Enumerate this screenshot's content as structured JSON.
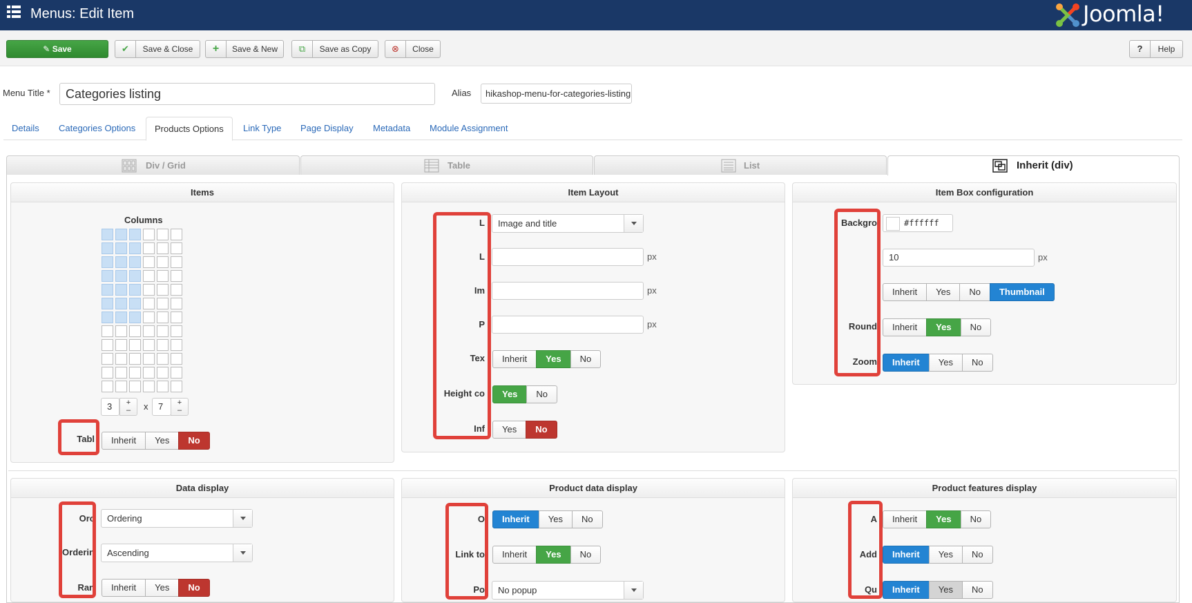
{
  "header": {
    "title": "Menus: Edit Item",
    "brand": "Joomla!",
    "bar_color": "#1a3867"
  },
  "toolbar": {
    "save": "Save",
    "save_close": "Save & Close",
    "save_new": "Save & New",
    "save_copy": "Save as Copy",
    "close": "Close",
    "help": "Help"
  },
  "form": {
    "menu_title_label": "Menu Title *",
    "menu_title_value": "Categories listing",
    "alias_label": "Alias",
    "alias_value": "hikashop-menu-for-categories-listing"
  },
  "tabs": [
    "Details",
    "Categories Options",
    "Products Options",
    "Link Type",
    "Page Display",
    "Metadata",
    "Module Assignment"
  ],
  "active_tab": "Products Options",
  "layout_tabs": [
    "Div / Grid",
    "Table",
    "List",
    "Inherit (div)"
  ],
  "active_layout_tab": "Inherit (div)",
  "items_panel": {
    "title": "Items",
    "columns_label": "Columns",
    "grid": {
      "cols": 6,
      "rows": 12,
      "selected_cols": 3,
      "selected_rows": 7
    },
    "cols_value": "3",
    "rows_value": "7",
    "times": "x",
    "plus": "+",
    "minus": "–",
    "table_label": "Tabl",
    "table_options": [
      "Inherit",
      "Yes",
      "No"
    ]
  },
  "item_layout_panel": {
    "title": "Item Layout",
    "labels": [
      "L",
      "L",
      "Im",
      "P",
      "Tex",
      "Height co",
      "Inf"
    ],
    "layout_select": "Image and title",
    "px": "px",
    "text_options": [
      "Inherit",
      "Yes",
      "No"
    ],
    "height_options": [
      "Yes",
      "No"
    ],
    "info_options": [
      "Yes",
      "No"
    ]
  },
  "item_box_panel": {
    "title": "Item Box configuration",
    "labels": [
      "Backgro",
      "Round",
      "Zoom"
    ],
    "color_value": "#ffffff",
    "padding_value": "10",
    "px": "px",
    "border_options": [
      "Inherit",
      "Yes",
      "No",
      "Thumbnail"
    ],
    "round_options": [
      "Inherit",
      "Yes",
      "No"
    ],
    "zoom_options": [
      "Inherit",
      "Yes",
      "No"
    ]
  },
  "data_display_panel": {
    "title": "Data display",
    "labels": [
      "Orc",
      "Orderin",
      "Ran"
    ],
    "order_select": "Ordering",
    "direction_select": "Ascending",
    "random_options": [
      "Inherit",
      "Yes",
      "No"
    ]
  },
  "product_data_panel": {
    "title": "Product data display",
    "labels": [
      "O",
      "Link to",
      "Po"
    ],
    "o_options": [
      "Inherit",
      "Yes",
      "No"
    ],
    "link_options": [
      "Inherit",
      "Yes",
      "No"
    ],
    "popup_select": "No popup"
  },
  "product_features_panel": {
    "title": "Product features display",
    "labels": [
      "A",
      "Add",
      "Qu"
    ],
    "a_options": [
      "Inherit",
      "Yes",
      "No"
    ],
    "add_options": [
      "Inherit",
      "Yes",
      "No"
    ],
    "qu_options": [
      "Inherit",
      "Yes",
      "No"
    ]
  },
  "colors": {
    "green": "#46a546",
    "red": "#bd362f",
    "blue": "#2384d3",
    "annotation": "#e0413a"
  }
}
